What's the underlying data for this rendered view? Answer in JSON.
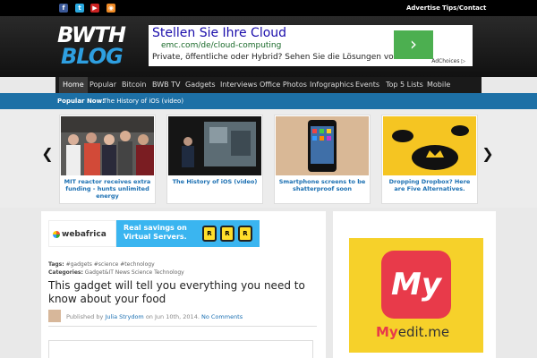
{
  "topbar": {
    "social": [
      {
        "icon": "facebook-icon",
        "glyph": "f",
        "color": "#3b5998"
      },
      {
        "icon": "twitter-icon",
        "glyph": "t",
        "color": "#2aa9e0"
      },
      {
        "icon": "youtube-icon",
        "glyph": "▶",
        "color": "#cc2222"
      },
      {
        "icon": "rss-icon",
        "glyph": "◉",
        "color": "#f08a24"
      }
    ],
    "links": [
      "Advertise",
      "Tips/Contact"
    ]
  },
  "logo": {
    "line1": "BWTH",
    "line2": "BLOG"
  },
  "ad": {
    "title": "Stellen Sie Ihre Cloud",
    "url": "emc.com/de/cloud-computing",
    "desc": "Private, öffentliche oder Hybrid? Sehen Sie die Lösungen von EMC.",
    "go_glyph": "›",
    "choices": "AdChoices ▷"
  },
  "nav": {
    "items": [
      "Home",
      "Popular",
      "Bitcoin",
      "BWB TV",
      "Gadgets",
      "Interviews",
      "Office Photos",
      "Infographics",
      "Events",
      "Top 5 Lists",
      "Mobile"
    ],
    "active": 0
  },
  "popular": {
    "label": "Popular Now:",
    "link": "The History of iOS (video)"
  },
  "carousel": {
    "prev_glyph": "❮",
    "next_glyph": "❯",
    "cards": [
      {
        "caption": "MIT reactor receives extra funding - hunts unlimited energy"
      },
      {
        "caption": "The History of iOS (video)"
      },
      {
        "caption": "Smartphone screens to be shatterproof soon"
      },
      {
        "caption": "Dropping Dropbox? Here are Five Alternatives."
      }
    ]
  },
  "banner": {
    "brand": "webafrica",
    "tagline": "Real savings on Virtual Servers.",
    "coin_glyph": "R"
  },
  "article": {
    "tags_label": "Tags:",
    "tags": "#gadgets #science #technology",
    "categories_label": "Categories:",
    "categories": "Gadget&IT News Science Technology",
    "title": "This gadget will tell you everything you need to know about your food",
    "published_by": "Published by",
    "author": "Julia Strydom",
    "on": "on Jun 10th, 2014.",
    "comments": "No Comments"
  },
  "sidebar_ad": {
    "mark": "My",
    "brand": "My",
    "brand_suffix": "edit.me"
  }
}
